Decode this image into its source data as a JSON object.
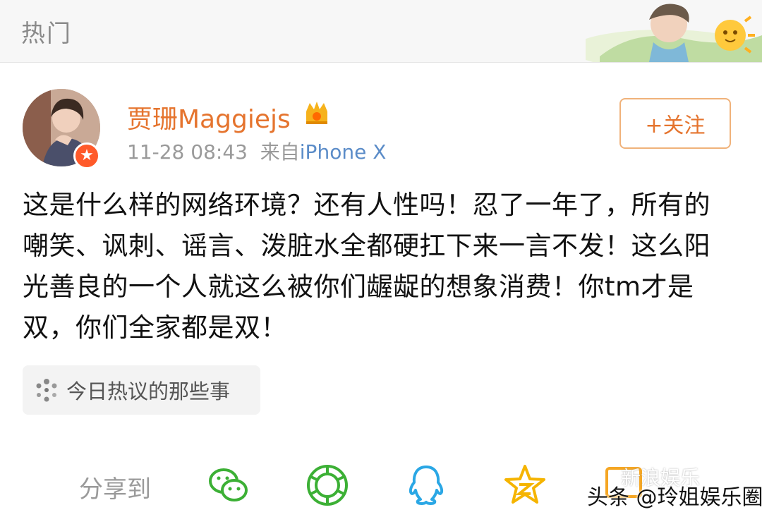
{
  "header": {
    "title": "热门"
  },
  "post": {
    "author": "贾珊Maggiejs",
    "time": "11-28 08:43",
    "source_prefix": "来自",
    "device": "iPhone X",
    "follow_label": "+关注",
    "text": "这是什么样的网络环境？还有人性吗！忍了一年了，所有的嘲笑、讽刺、谣言、泼脏水全都硬扛下来一言不发！这么阳光善良的一个人就这么被你们龌龊的想象消费！你tm才是双，你们全家都是双！",
    "topic": "今日热议的那些事"
  },
  "share": {
    "label": "分享到",
    "targets": [
      "wechat-icon",
      "moments-icon",
      "qq-icon",
      "qzone-icon",
      "more-icon"
    ]
  },
  "watermark": {
    "line1": "新浪娱乐",
    "line2": "头条 @玲姐娱乐圈"
  },
  "colors": {
    "accent": "#e5742e",
    "link": "#5b8cc8",
    "share_green": "#3cb035",
    "share_blue": "#2aa7e5",
    "share_yellow": "#f5b400"
  }
}
